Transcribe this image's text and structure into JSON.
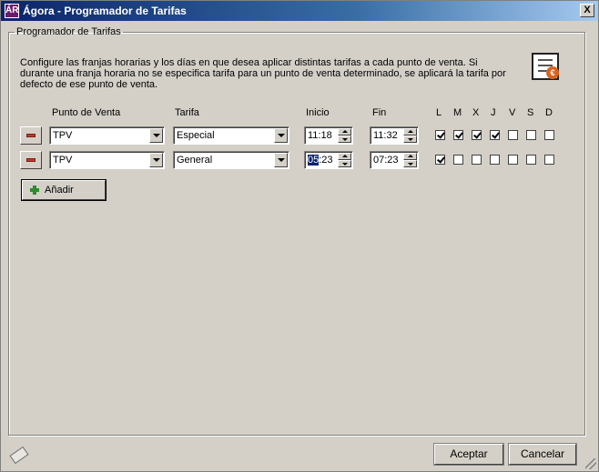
{
  "window": {
    "title": "Ágora - Programador de Tarifas",
    "app_icon_text": "ÁR",
    "close_label": "X"
  },
  "group": {
    "legend": "Programador de Tarifas",
    "description": "Configure las franjas horarias y los días en que desea aplicar distintas tarifas a cada punto de venta. Si durante una franja horaria no se especifica tarifa para un punto de venta determinado, se aplicará la tarifa por defecto de ese punto de venta.",
    "icon": "tariff-document-icon",
    "coin_symbol": "€"
  },
  "headers": {
    "punto_venta": "Punto de Venta",
    "tarifa": "Tarifa",
    "inicio": "Inicio",
    "fin": "Fin",
    "days": [
      "L",
      "M",
      "X",
      "J",
      "V",
      "S",
      "D"
    ]
  },
  "rows": [
    {
      "punto_venta": "TPV",
      "tarifa": "Especial",
      "inicio": "11:18",
      "inicio_sel": "",
      "inicio_rest": "11:18",
      "fin": "11:32",
      "days": [
        true,
        true,
        true,
        true,
        false,
        false,
        false
      ]
    },
    {
      "punto_venta": "TPV",
      "tarifa": "General",
      "inicio": "05:23",
      "inicio_sel": "05",
      "inicio_rest": ":23",
      "fin": "07:23",
      "days": [
        true,
        false,
        false,
        false,
        false,
        false,
        false
      ]
    }
  ],
  "add_button": {
    "label": "Añadir"
  },
  "footer": {
    "accept_label": "Aceptar",
    "cancel_label": "Cancelar"
  },
  "colors": {
    "titlebar_start": "#0a246a",
    "face": "#d4d0c8",
    "remove_red": "#c0392b",
    "add_green": "#2e8b2e"
  }
}
